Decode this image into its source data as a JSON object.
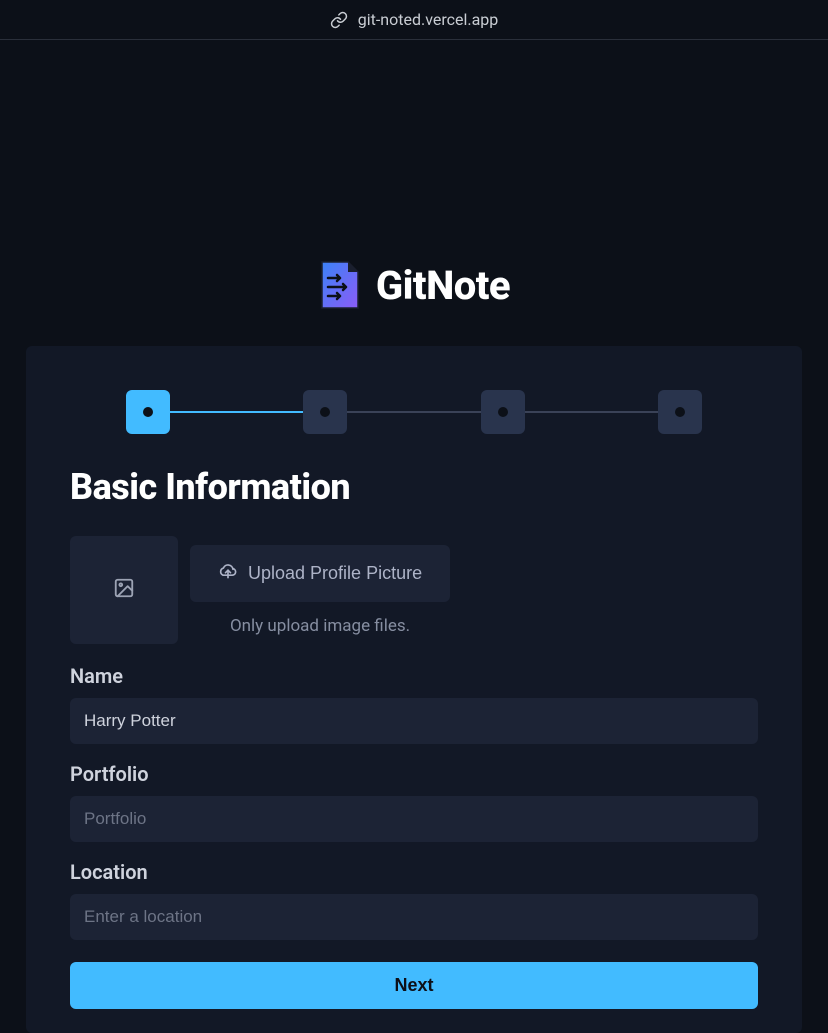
{
  "browser": {
    "url": "git-noted.vercel.app"
  },
  "app": {
    "name": "GitNote"
  },
  "stepper": {
    "steps": [
      {
        "active": true
      },
      {
        "active": false
      },
      {
        "active": false
      },
      {
        "active": false
      }
    ]
  },
  "page": {
    "title": "Basic Information"
  },
  "upload": {
    "button_label": "Upload Profile Picture",
    "hint": "Only upload image files."
  },
  "fields": {
    "name": {
      "label": "Name",
      "value": "Harry Potter",
      "placeholder": ""
    },
    "portfolio": {
      "label": "Portfolio",
      "value": "",
      "placeholder": "Portfolio"
    },
    "location": {
      "label": "Location",
      "value": "",
      "placeholder": "Enter a location"
    }
  },
  "actions": {
    "next": "Next"
  }
}
